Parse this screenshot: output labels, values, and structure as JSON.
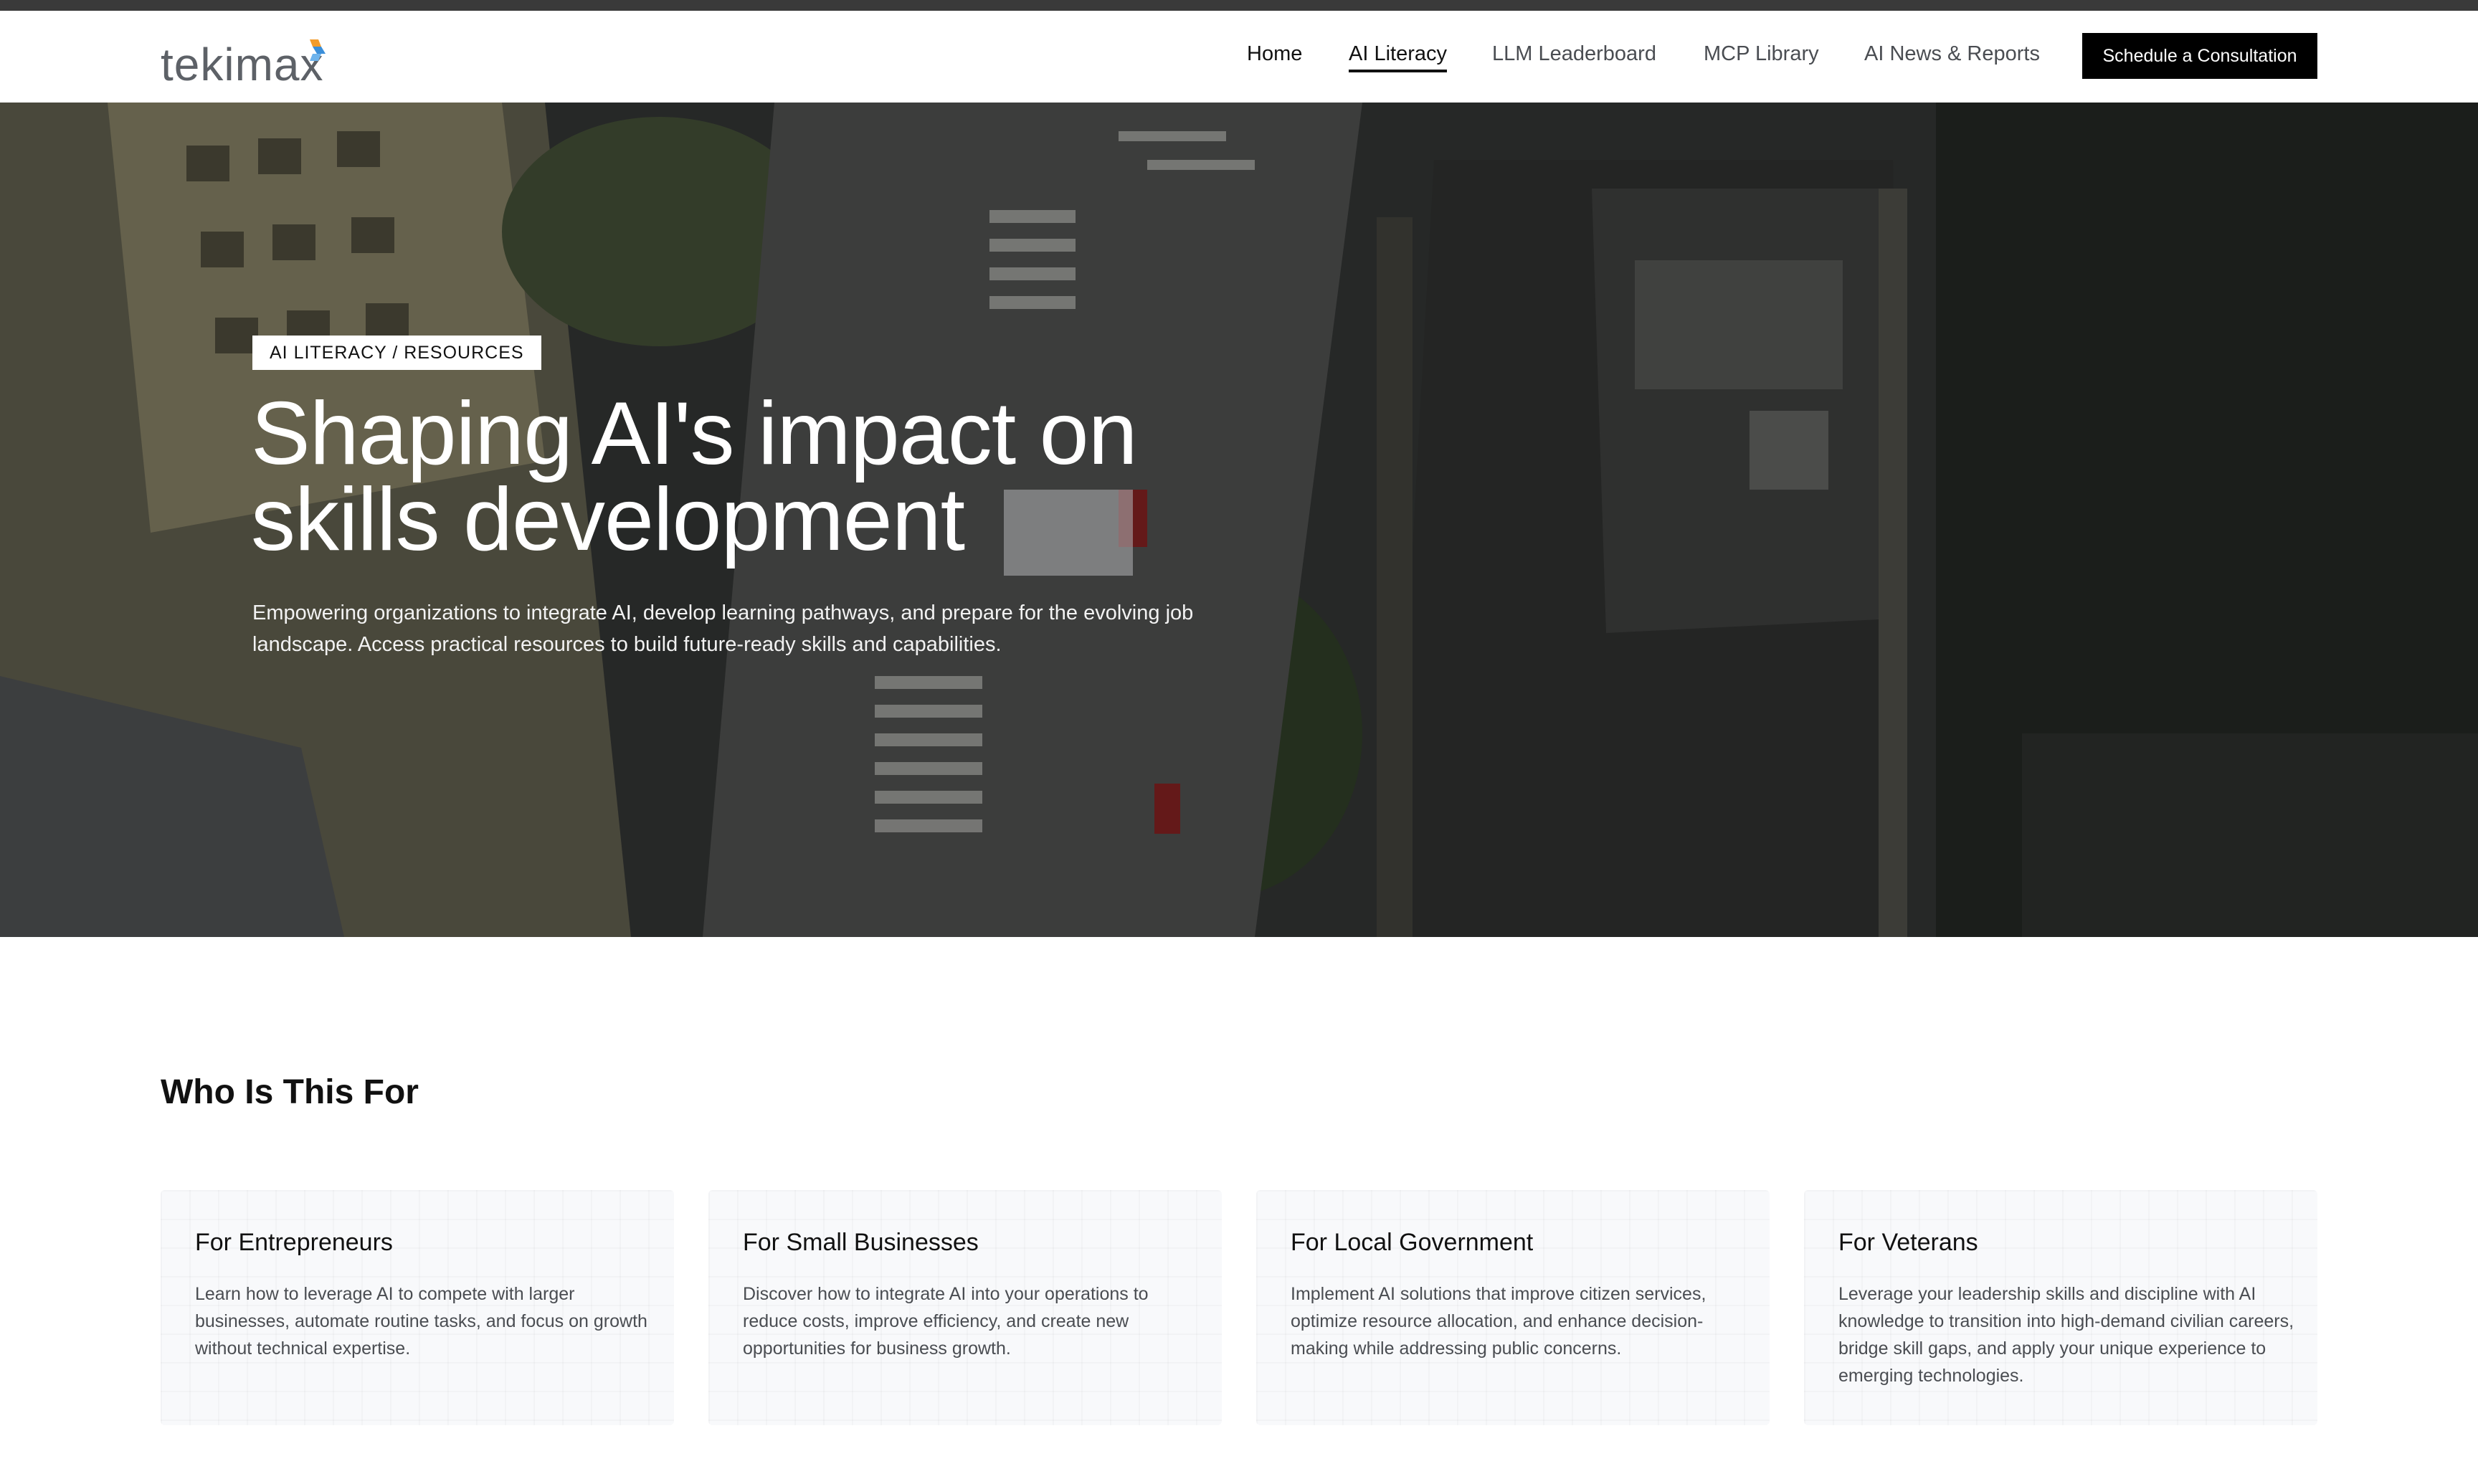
{
  "brand": {
    "name": "tekimax"
  },
  "nav": {
    "items": [
      {
        "label": "Home"
      },
      {
        "label": "AI Literacy"
      },
      {
        "label": "LLM Leaderboard"
      },
      {
        "label": "MCP Library"
      },
      {
        "label": "AI News & Reports"
      }
    ],
    "active": "AI Literacy",
    "cta": "Schedule a Consultation"
  },
  "hero": {
    "badge": "AI LITERACY / RESOURCES",
    "title_line1": "Shaping AI's impact on",
    "title_line2": "skills development",
    "subtitle": "Empowering organizations to integrate AI, develop learning pathways, and prepare for the evolving job landscape. Access practical resources to build future-ready skills and capabilities."
  },
  "who": {
    "title": "Who Is This For",
    "cards": [
      {
        "title": "For Entrepreneurs",
        "text": "Learn how to leverage AI to compete with larger businesses, automate routine tasks, and focus on growth without technical expertise."
      },
      {
        "title": "For Small Businesses",
        "text": "Discover how to integrate AI into your operations to reduce costs, improve efficiency, and create new opportunities for business growth."
      },
      {
        "title": "For Local Government",
        "text": "Implement AI solutions that improve citizen services, optimize resource allocation, and enhance decision-making while addressing public concerns."
      },
      {
        "title": "For Veterans",
        "text": "Leverage your leadership skills and discipline with AI knowledge to transition into high-demand civilian careers, bridge skill gaps, and apply your unique experience to emerging technologies."
      }
    ]
  },
  "colors": {
    "cta_bg": "#000000",
    "logo_mark_orange": "#f39c2b",
    "logo_mark_blue": "#3b8fd9"
  },
  "icons": {
    "logo_mark": "tekimax-cube-icon"
  }
}
